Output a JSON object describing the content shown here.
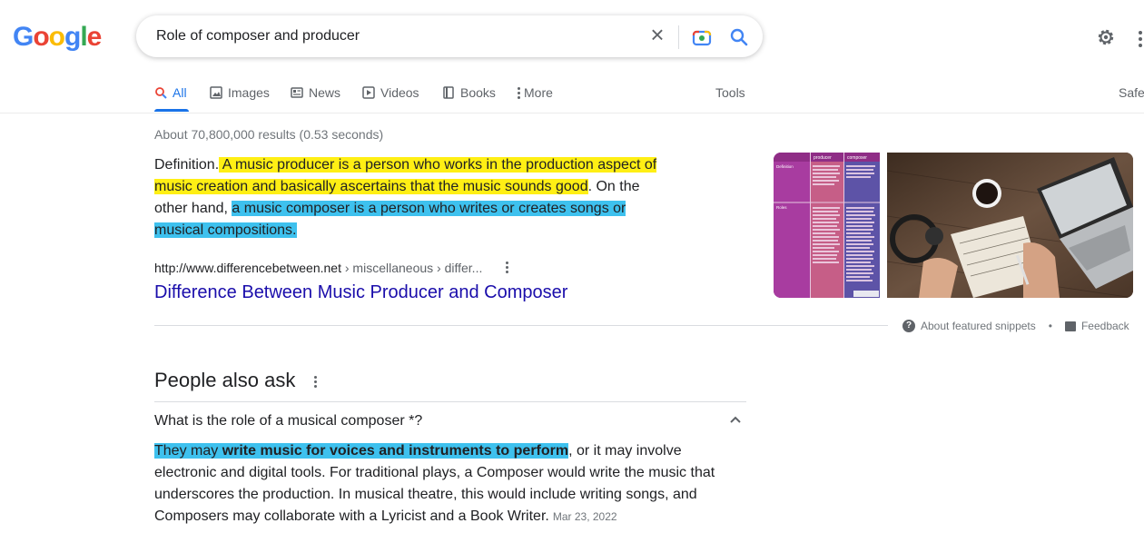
{
  "header": {
    "logo_letters": [
      "G",
      "o",
      "o",
      "g",
      "l",
      "e"
    ],
    "logo_colors": [
      "#4285f4",
      "#ea4335",
      "#fbbc05",
      "#4285f4",
      "#34a853",
      "#ea4335"
    ],
    "query": "Role of composer and producer",
    "clear_glyph": "×"
  },
  "tabs": [
    {
      "label": "All",
      "icon": "search-icon",
      "active": true
    },
    {
      "label": "Images",
      "icon": "image-icon"
    },
    {
      "label": "News",
      "icon": "news-icon"
    },
    {
      "label": "Videos",
      "icon": "play-icon"
    },
    {
      "label": "Books",
      "icon": "book-icon"
    },
    {
      "label": "More",
      "icon": "vertical-dots-icon"
    }
  ],
  "tools_label": "Tools",
  "safe_label": "Safe",
  "results_count": "About 70,800,000 results (0.53 seconds)",
  "snippet": {
    "p1": "Definition.",
    "hl1": " A music producer is a person who works in the production aspect of music creation and basically ascertains that the music sounds good",
    "p2": ". On the other hand, ",
    "hl2": "a music composer is a person who writes or creates songs or musical compositions.",
    "highlight_colors": {
      "yellow": "#ffef14",
      "blue": "#3ec1ee"
    },
    "cite_domain": "http://www.differencebetween.net",
    "cite_path": " › miscellaneous › differ...",
    "link_title": "Difference Between Music Producer and Composer",
    "link_color": "#1a0dab"
  },
  "featured_footer": {
    "about_label": "About featured snippets",
    "separator": "•",
    "feedback_label": "Feedback"
  },
  "paa": {
    "title": "People also ask",
    "question": "What is the role of a musical composer *?",
    "answer_pre": "They may ",
    "answer_bold": "write music for voices and instruments to perform",
    "answer_post": ", or it may involve electronic and digital tools. For traditional plays, a Composer would write the music that underscores the production. In musical theatre, this would include writing songs, and Composers may collaborate with a Lyricist and a Book Writer.",
    "date": "Mar 23, 2022"
  },
  "table_image": {
    "cells": [
      "producer",
      "composer",
      "Definition",
      "Roles"
    ]
  }
}
